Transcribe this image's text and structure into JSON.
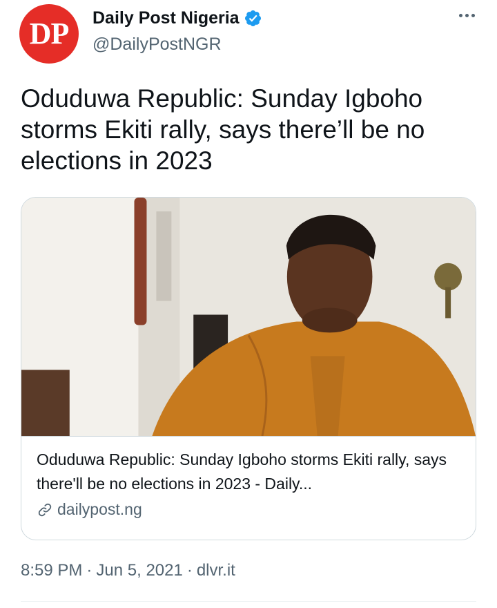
{
  "header": {
    "avatar_text": "DP",
    "display_name": "Daily Post Nigeria",
    "handle": "@DailyPostNGR"
  },
  "tweet": {
    "text": "Oduduwa Republic: Sunday Igboho storms Ekiti rally, says there’ll be no elections in 2023"
  },
  "card": {
    "title": "Oduduwa Republic: Sunday Igboho storms Ekiti rally, says there'll be no elections in 2023 - Daily...",
    "domain": "dailypost.ng"
  },
  "meta": {
    "time": "8:59 PM",
    "separator1": "·",
    "date": "Jun 5, 2021",
    "separator2": "·",
    "source": "dlvr.it"
  },
  "colors": {
    "avatar_bg": "#e52d27",
    "verified": "#1d9bf0",
    "secondary_text": "#536471",
    "border": "#cfd9de"
  },
  "icons": {
    "verified": "verified-badge-icon",
    "more": "more-options-icon",
    "link": "link-icon"
  }
}
